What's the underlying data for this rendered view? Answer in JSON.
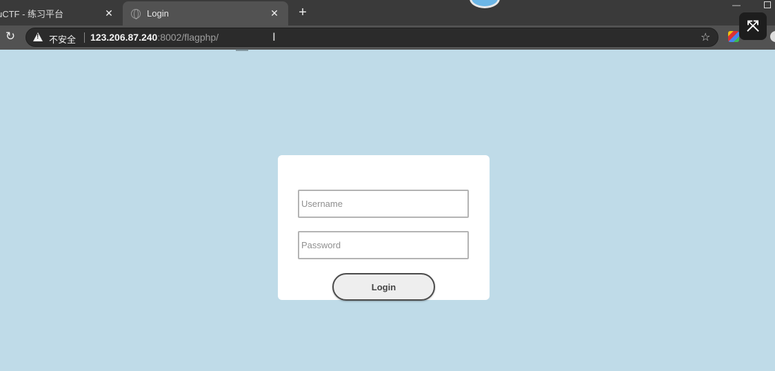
{
  "browser": {
    "tabs": [
      {
        "title": "uCTF - 练习平台",
        "close": "✕"
      },
      {
        "title": "Login",
        "close": "✕"
      }
    ],
    "new_tab": "+",
    "security_label": "不安全",
    "url_host": "123.206.87.240",
    "url_rest": ":8002/flagphp/"
  },
  "login": {
    "username_placeholder": "Username",
    "password_placeholder": "Password",
    "button_label": "Login"
  },
  "icons": [
    "globe-icon",
    "reload-icon",
    "warning-icon",
    "star-icon",
    "extension-icon",
    "fullscreen-icon"
  ],
  "colors": {
    "page_background": "#bfdbe8",
    "card_background": "#ffffff",
    "tabstrip": "#3a3a3a",
    "toolbar": "#525252"
  }
}
